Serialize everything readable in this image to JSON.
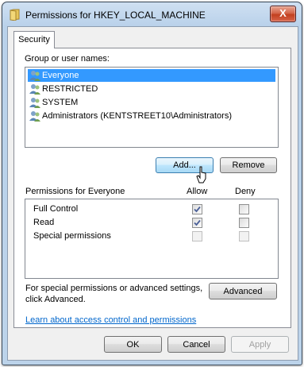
{
  "window": {
    "title": "Permissions for HKEY_LOCAL_MACHINE",
    "close_label": "X"
  },
  "tab": {
    "label": "Security"
  },
  "group_section": {
    "label": "Group or user names:",
    "users": [
      {
        "name": "Everyone",
        "selected": true
      },
      {
        "name": "RESTRICTED",
        "selected": false
      },
      {
        "name": "SYSTEM",
        "selected": false
      },
      {
        "name": "Administrators (KENTSTREET10\\Administrators)",
        "selected": false
      }
    ],
    "add_button": "Add...",
    "remove_button": "Remove"
  },
  "permissions": {
    "header": "Permissions for Everyone",
    "allow_header": "Allow",
    "deny_header": "Deny",
    "rows": [
      {
        "label": "Full Control",
        "allow": true,
        "deny": false,
        "disabled": false
      },
      {
        "label": "Read",
        "allow": true,
        "deny": false,
        "disabled": false
      },
      {
        "label": "Special permissions",
        "allow": false,
        "deny": false,
        "disabled": true
      }
    ]
  },
  "advanced": {
    "text_line1": "For special permissions or advanced settings,",
    "text_line2": "click Advanced.",
    "button": "Advanced"
  },
  "help_link": "Learn about access control and permissions",
  "footer": {
    "ok": "OK",
    "cancel": "Cancel",
    "apply": "Apply"
  },
  "colors": {
    "selection": "#3399ff",
    "link": "#0066cc",
    "close_button": "#c2401f"
  }
}
